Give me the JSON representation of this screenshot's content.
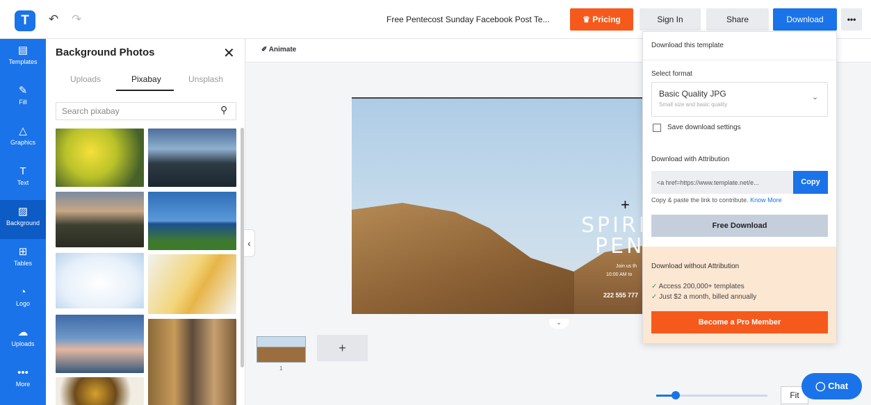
{
  "toolbar": {
    "logo": "T",
    "undo_icon": "↶",
    "redo_icon": "↷",
    "doc_title": "Free Pentecost Sunday Facebook Post Te...",
    "pricing_label": "Pricing",
    "signin_label": "Sign In",
    "share_label": "Share",
    "download_label": "Download",
    "more_label": "•••"
  },
  "rail": {
    "items": [
      {
        "label": "Templates",
        "icon": "▤"
      },
      {
        "label": "Fill",
        "icon": "✎"
      },
      {
        "label": "Graphics",
        "icon": "△"
      },
      {
        "label": "Text",
        "icon": "T"
      },
      {
        "label": "Background",
        "icon": "▨"
      },
      {
        "label": "Tables",
        "icon": "⊞"
      },
      {
        "label": "Logo",
        "icon": "◔"
      },
      {
        "label": "Uploads",
        "icon": "☁"
      },
      {
        "label": "More",
        "icon": "•••"
      }
    ],
    "active": "Background"
  },
  "panel": {
    "title": "Background Photos",
    "close_icon": "✕",
    "tabs": [
      "Uploads",
      "Pixabay",
      "Unsplash"
    ],
    "active_tab": "Pixabay",
    "search_placeholder": "Search pixabay",
    "search_icon": "⚲",
    "collapse_icon": "‹"
  },
  "workspace": {
    "animate_label": "✐ Animate",
    "crosshair": "+",
    "canvas_chevron": "⌄",
    "canvas_text": {
      "line1": "SPIRIT",
      "line2": "PENT",
      "line3": "Join us th",
      "line4": "10:00 AM to",
      "line5": "222 555 777"
    },
    "page_number": "1",
    "add_page_icon": "+",
    "fit_label": "Fit"
  },
  "chat": {
    "label": "Chat",
    "icon": "◯"
  },
  "download_menu": {
    "heading": "Download this template",
    "select_format_label": "Select format",
    "format_name": "Basic Quality JPG",
    "format_desc": "Small size and basic quality",
    "format_chevron": "⌄",
    "save_settings_label": "Save download settings",
    "attribution_label": "Download with Attribution",
    "attribution_value": "<a href=https://www.template.net/e...",
    "copy_label": "Copy",
    "copy_hint": "Copy & paste the link to contribute.",
    "know_more": "Know More",
    "free_download_label": "Free Download",
    "without_attr_label": "Download without Attribution",
    "features": [
      "Access 200,000+ templates",
      "Just $2 a month, billed annually"
    ],
    "check_icon": "✓",
    "pro_label": "Become a Pro Member"
  },
  "colors": {
    "brand": "#1a73e8",
    "accent": "#f55a1c",
    "pro_bg": "#fbe7d2"
  }
}
